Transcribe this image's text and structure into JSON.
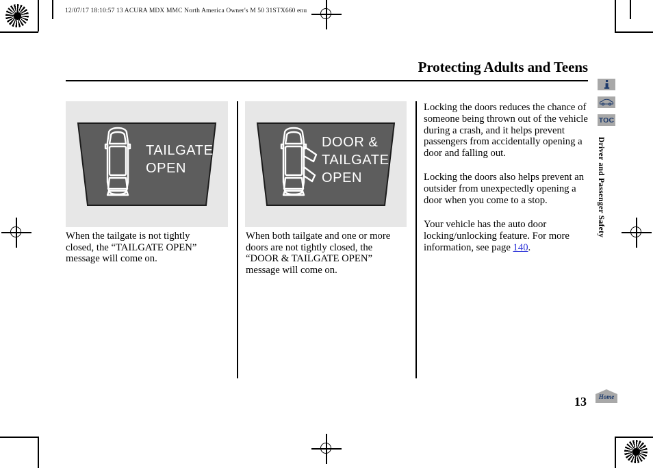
{
  "scan": {
    "header_line": "12/07/17 18:10:57   13 ACURA MDX MMC North America Owner's M 50 31STX660 enu"
  },
  "header": {
    "title": "Protecting Adults and Teens"
  },
  "nav_icons": [
    {
      "name": "info-icon",
      "label": "i"
    },
    {
      "name": "vehicle-icon",
      "label": ""
    },
    {
      "name": "toc-icon",
      "label": "TOC"
    }
  ],
  "side_tab": {
    "label": "Driver and Passenger Safety"
  },
  "figures": [
    {
      "display_lines": [
        "TAILGATE",
        "OPEN"
      ],
      "caption": "When the tailgate is not tightly closed, the “TAILGATE OPEN” message will come on.",
      "doors_open": false
    },
    {
      "display_lines": [
        "DOOR &",
        "TAILGATE",
        "OPEN"
      ],
      "caption": "When both tailgate and one or more doors are not tightly closed, the “DOOR & TAILGATE OPEN” message will come on.",
      "doors_open": true
    }
  ],
  "body": {
    "paragraph_1": "Locking the doors reduces the chance of someone being thrown out of the vehicle during a crash, and it helps prevent passengers from accidentally opening a door and falling out.",
    "paragraph_2": "Locking the doors also helps prevent an outsider from unexpectedly opening a door when you come to a stop.",
    "paragraph_3_before": "Your vehicle has the auto door locking/unlocking feature. For more information, see page ",
    "paragraph_3_link": "140",
    "paragraph_3_after": "."
  },
  "footer": {
    "page_number": "13",
    "home_label": "Home"
  },
  "colors": {
    "display_background": "#5d5d5d",
    "figure_background": "#e7e7e7",
    "link": "#2a31d8",
    "nav_icon_background": "#a8a8a8",
    "nav_icon_glyph": "#1d3a6b"
  }
}
